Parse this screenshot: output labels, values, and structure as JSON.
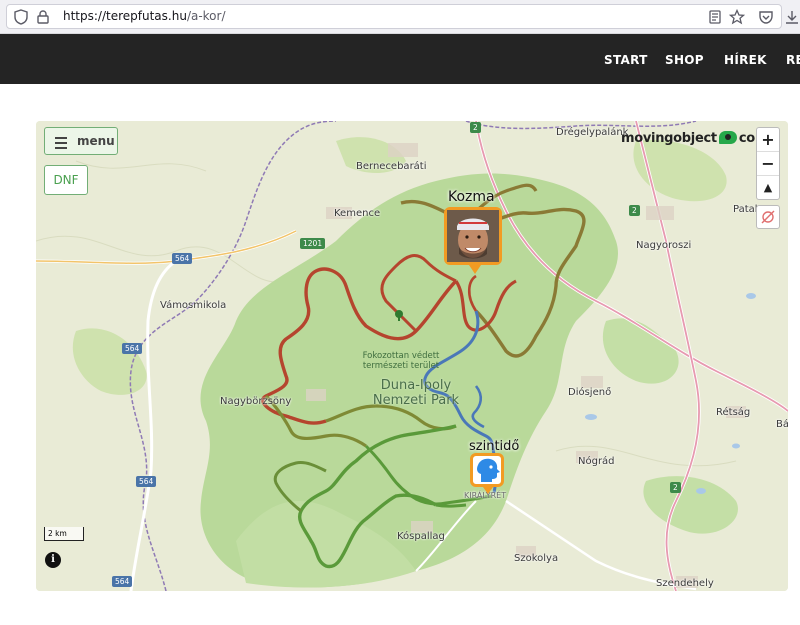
{
  "browser": {
    "url_host": "https://terepfutas.hu",
    "url_path": "/a-kor/"
  },
  "nav": {
    "items": [
      "START",
      "SHOP",
      "HÍREK",
      "RE"
    ]
  },
  "map": {
    "menu_label": "menu",
    "dnf_label": "DNF",
    "logo_text_left": "movingobject",
    "logo_text_right": "co",
    "zoom_in": "+",
    "zoom_out": "−",
    "compass": "▲",
    "scale_label": "2 km",
    "info": "i",
    "places": {
      "dregelypalank": "Drégelypalánk",
      "bernecebarati": "Bernecebaráti",
      "kemence": "Kemence",
      "patak": "Patak",
      "nagyoroszi": "Nagyoroszi",
      "vamosmikola": "Vámosmikola",
      "nagyborzsony": "Nagybörzsöny",
      "diosjeno": "Diósjenő",
      "retsag": "Rétság",
      "ba": "Bá",
      "nograd": "Nógrád",
      "kospallag": "Kóspallag",
      "szokolya": "Szokolya",
      "szendehely": "Szendehely",
      "kiraly": "KIRÁLYRÉT"
    },
    "park_label_1": "Duna-Ipoly",
    "park_label_2": "Nemzeti Park",
    "protected_1": "Fokozottan védett",
    "protected_2": "természeti terület",
    "shields": {
      "r2a": "2",
      "r2b": "2",
      "r2c": "2",
      "r1201": "1201",
      "r564a": "564",
      "r564b": "564",
      "r564c": "564",
      "r564d": "564"
    },
    "runners": [
      {
        "name": "Kozma"
      },
      {
        "name": "szintidő"
      }
    ],
    "colors": {
      "forest": "#b9d99a",
      "route_red": "#b5452e",
      "route_green": "#5a9a3a",
      "route_olive": "#7f8a35",
      "route_blue": "#4a78b8",
      "marker": "#f29b23"
    }
  }
}
